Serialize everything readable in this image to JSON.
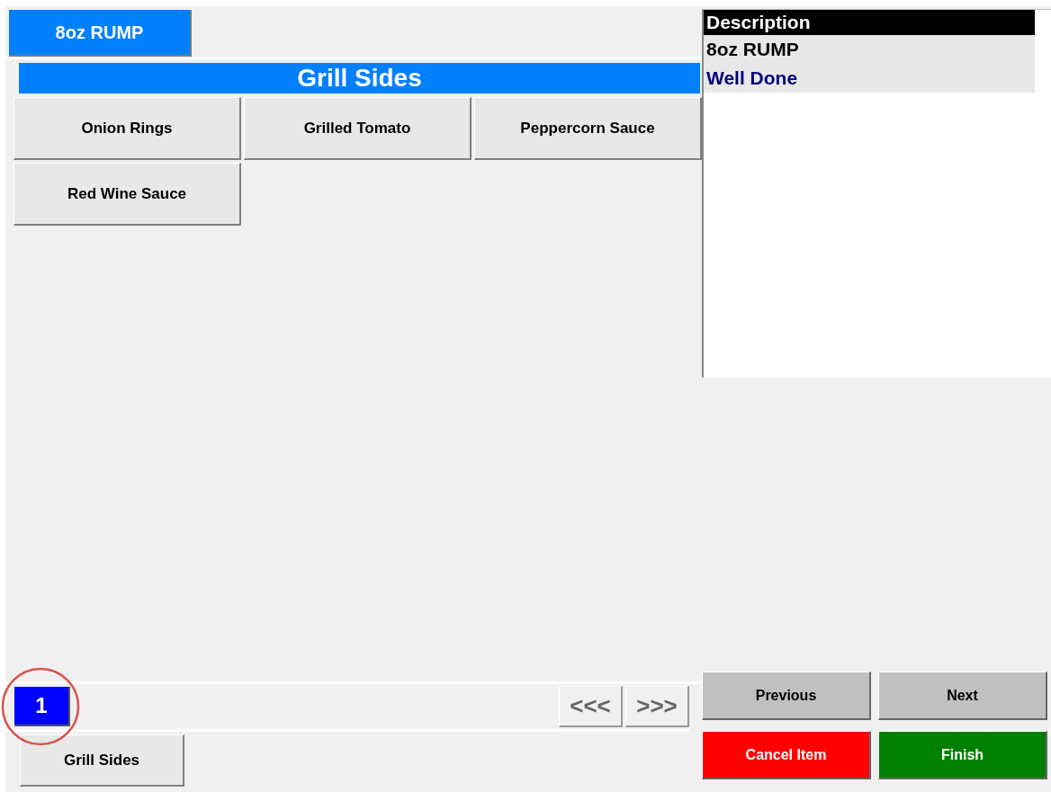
{
  "item_button": "8oz RUMP",
  "group": {
    "title": "Grill Sides",
    "options": [
      {
        "label": "Onion Rings"
      },
      {
        "label": "Grilled Tomato"
      },
      {
        "label": "Peppercorn Sauce"
      },
      {
        "label": "Red Wine Sauce"
      }
    ]
  },
  "pages": [
    {
      "label": "1",
      "selected": true,
      "highlighted": true
    }
  ],
  "page_nav": {
    "prev": "<<<",
    "next": ">>>"
  },
  "group_tabs": [
    {
      "label": "Grill Sides"
    }
  ],
  "description": {
    "heading": "Description",
    "rows": [
      {
        "text": "8oz RUMP",
        "kind": "item"
      },
      {
        "text": "Well Done",
        "kind": "modifier"
      }
    ]
  },
  "actions": [
    {
      "label": "Previous",
      "kind": "neutral"
    },
    {
      "label": "Next",
      "kind": "neutral"
    },
    {
      "label": "Cancel Item",
      "kind": "danger"
    },
    {
      "label": "Finish",
      "kind": "confirm"
    }
  ]
}
